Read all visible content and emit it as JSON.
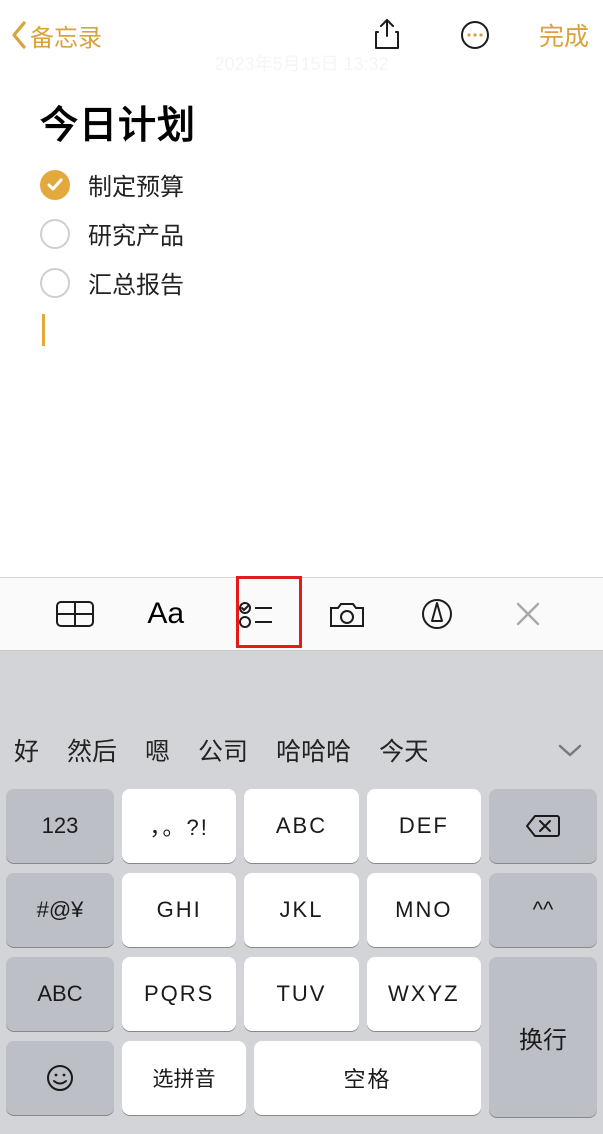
{
  "nav": {
    "back_label": "备忘录",
    "done_label": "完成",
    "timestamp": "2023年5月15日 13:32"
  },
  "note": {
    "title": "今日计划",
    "items": [
      {
        "text": "制定预算",
        "checked": true
      },
      {
        "text": "研究产品",
        "checked": false
      },
      {
        "text": "汇总报告",
        "checked": false
      }
    ]
  },
  "toolbar": {
    "aa_label": "Aa"
  },
  "candidates": {
    "items": [
      "好",
      "然后",
      "嗯",
      "公司",
      "哈哈哈",
      "今天"
    ]
  },
  "keyboard": {
    "left": [
      "123",
      "#@¥",
      "ABC"
    ],
    "rows": [
      [
        "，。?!",
        "ABC",
        "DEF"
      ],
      [
        "GHI",
        "JKL",
        "MNO"
      ],
      [
        "PQRS",
        "TUV",
        "WXYZ"
      ]
    ],
    "pinyin": "选拼音",
    "space": "空格",
    "face": "^^",
    "enter": "换行"
  }
}
